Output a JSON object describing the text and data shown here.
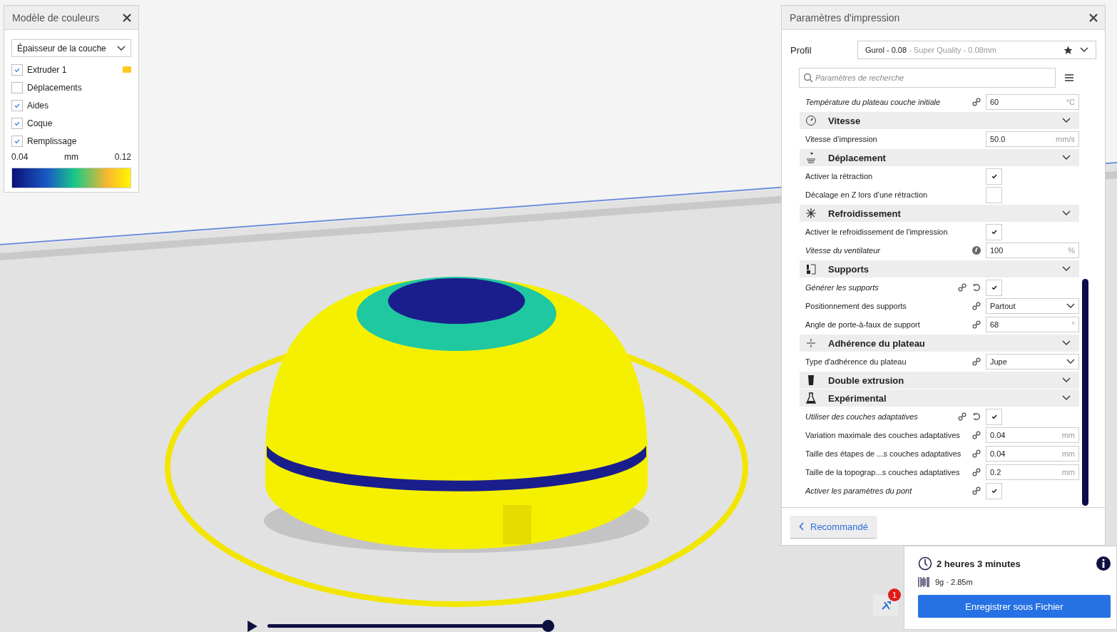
{
  "color_panel": {
    "title": "Modèle de couleurs",
    "scheme": "Épaisseur de la couche",
    "items": [
      {
        "label": "Extruder 1",
        "checked": true,
        "color": "#ffc924"
      },
      {
        "label": "Déplacements",
        "checked": false
      },
      {
        "label": "Aides",
        "checked": true
      },
      {
        "label": "Coque",
        "checked": true
      },
      {
        "label": "Remplissage",
        "checked": true
      }
    ],
    "legend": {
      "min": "0.04",
      "unit": "mm",
      "max": "0.12"
    }
  },
  "settings_panel": {
    "title": "Paramètres d'impression",
    "profile_label": "Profil",
    "profile_name": "Gurol - 0.08",
    "profile_detail": " - Super Quality - 0.08mm",
    "search_placeholder": "Paramètres de recherche",
    "rows": [
      {
        "kind": "number",
        "label": "Température du plateau couche initiale",
        "modified": true,
        "linked": true,
        "resettable": false,
        "formula": false,
        "value": "60",
        "unit": "°C"
      },
      {
        "kind": "header",
        "label": "Vitesse"
      },
      {
        "kind": "number",
        "label": "Vitesse d’impression",
        "modified": false,
        "linked": false,
        "resettable": false,
        "formula": false,
        "value": "50.0",
        "unit": "mm/s"
      },
      {
        "kind": "header",
        "label": "Déplacement"
      },
      {
        "kind": "checkbox",
        "label": "Activer la rétraction",
        "modified": false,
        "linked": false,
        "resettable": false,
        "formula": false,
        "checked": true
      },
      {
        "kind": "checkbox",
        "label": "Décalage en Z lors d’une rétraction",
        "modified": false,
        "linked": false,
        "resettable": false,
        "formula": false,
        "checked": false
      },
      {
        "kind": "header",
        "label": "Refroidissement"
      },
      {
        "kind": "checkbox",
        "label": "Activer le refroidissement de l'impression",
        "modified": false,
        "linked": false,
        "resettable": false,
        "formula": false,
        "checked": true
      },
      {
        "kind": "number",
        "label": "Vitesse du ventilateur",
        "modified": true,
        "linked": false,
        "resettable": false,
        "formula": true,
        "value": "100",
        "unit": "%"
      },
      {
        "kind": "header",
        "label": "Supports"
      },
      {
        "kind": "checkbox",
        "label": "Générer les supports",
        "modified": true,
        "linked": true,
        "resettable": true,
        "formula": false,
        "checked": true
      },
      {
        "kind": "select",
        "label": "Positionnement des supports",
        "modified": false,
        "linked": true,
        "resettable": false,
        "formula": false,
        "value": "Partout"
      },
      {
        "kind": "number",
        "label": "Angle de porte-à-faux de support",
        "modified": false,
        "linked": true,
        "resettable": false,
        "formula": false,
        "value": "68",
        "unit": "°"
      },
      {
        "kind": "header",
        "label": "Adhérence du plateau"
      },
      {
        "kind": "select",
        "label": "Type d'adhérence du plateau",
        "modified": false,
        "linked": true,
        "resettable": false,
        "formula": false,
        "value": "Jupe"
      },
      {
        "kind": "header",
        "label": "Double extrusion"
      },
      {
        "kind": "header",
        "label": "Expérimental"
      },
      {
        "kind": "checkbox",
        "label": "Utiliser des couches adaptatives",
        "modified": true,
        "linked": true,
        "resettable": true,
        "formula": false,
        "checked": true
      },
      {
        "kind": "number",
        "label": "Variation maximale des couches adaptatives",
        "modified": false,
        "linked": true,
        "resettable": false,
        "formula": false,
        "value": "0.04",
        "unit": "mm"
      },
      {
        "kind": "number",
        "label": "Taille des étapes de ...s couches adaptatives",
        "modified": false,
        "linked": true,
        "resettable": false,
        "formula": false,
        "value": "0.04",
        "unit": "mm"
      },
      {
        "kind": "number",
        "label": "Taille de la topograp...s couches adaptatives",
        "modified": false,
        "linked": true,
        "resettable": false,
        "formula": false,
        "value": "0.2",
        "unit": "mm"
      },
      {
        "kind": "checkbox",
        "label": "Activer les paramètres du pont",
        "modified": true,
        "linked": true,
        "resettable": false,
        "formula": false,
        "checked": true
      }
    ],
    "mode_button": "Recommandé"
  },
  "print_summary": {
    "time": "2 heures 3 minutes",
    "material": "9g · 2.85m",
    "save_button": "Enregistrer sous Fichier"
  },
  "tools_badge": "1",
  "layer_slider": {
    "level": 1
  }
}
